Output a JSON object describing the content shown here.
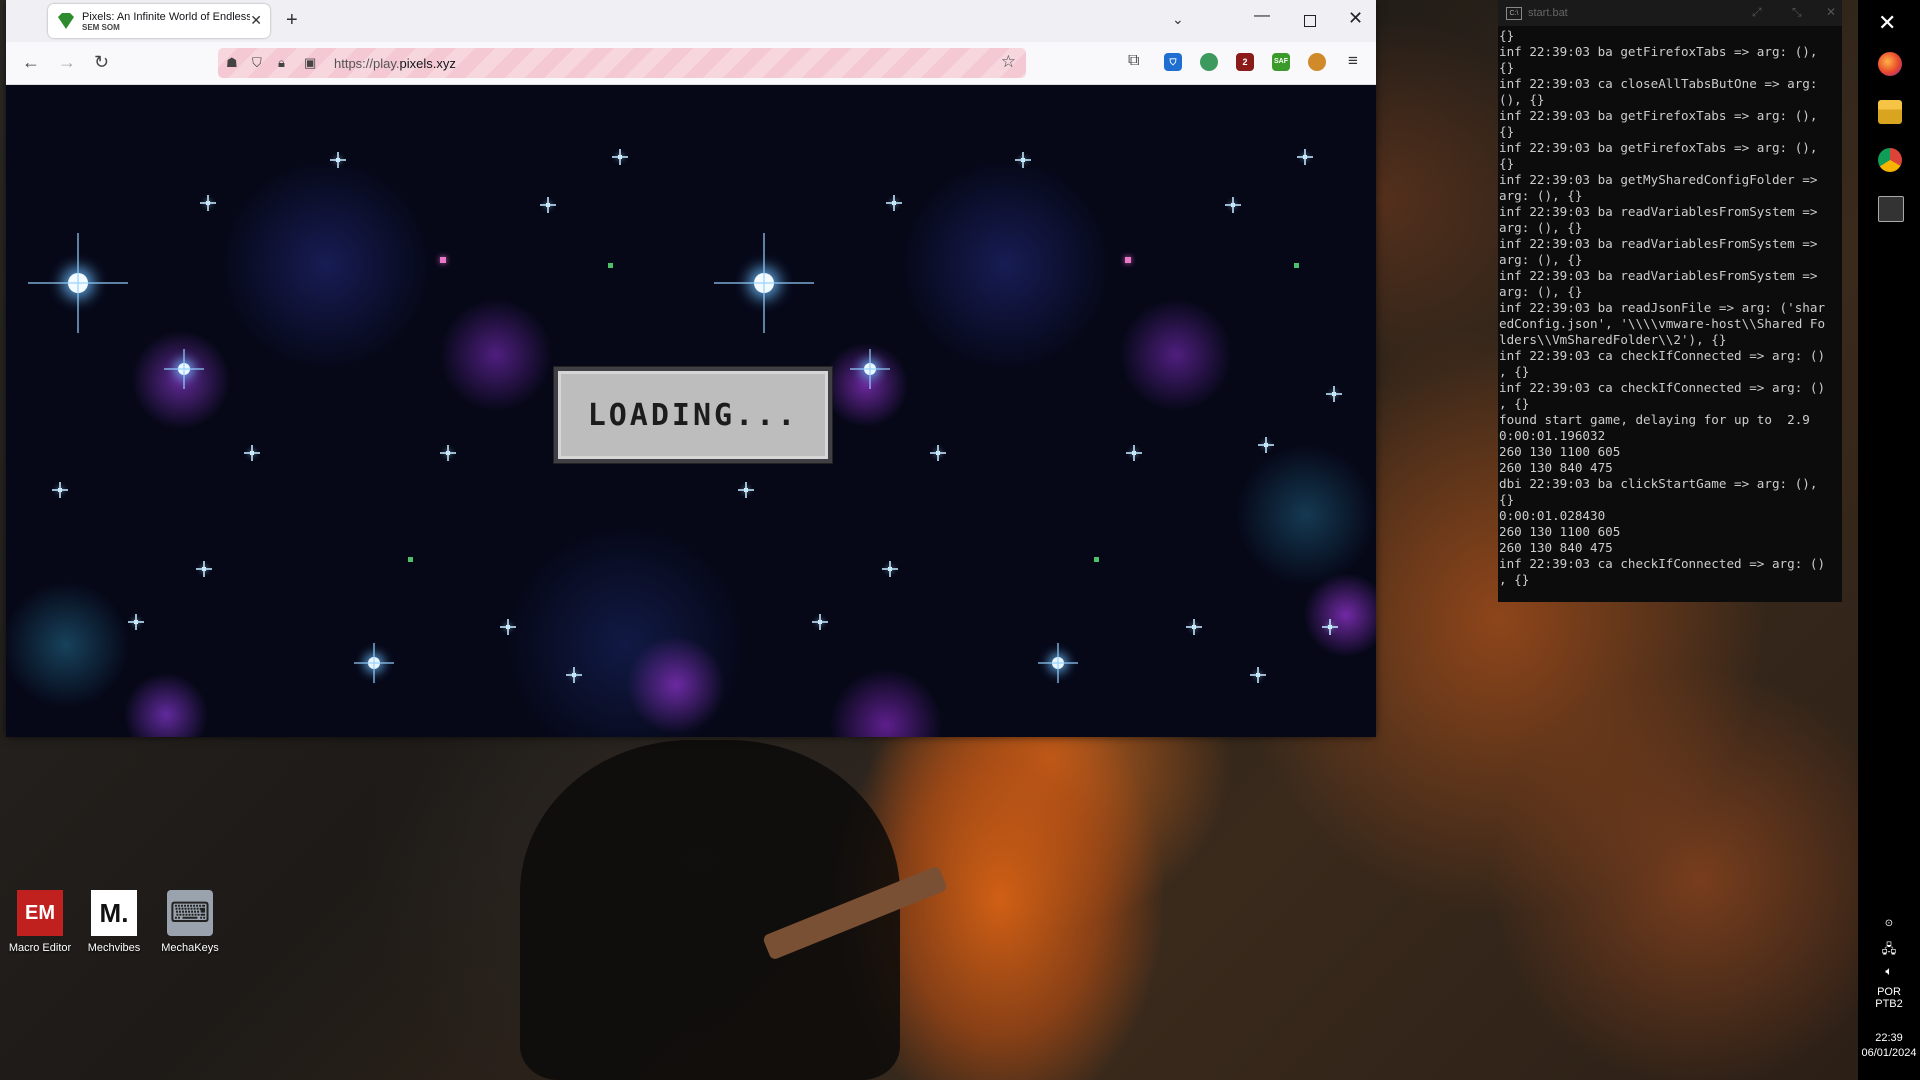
{
  "browser": {
    "tab_title": "Pixels: An Infinite World of Endless",
    "tab_subtitle": "SEM SOM",
    "url_prefix": "https://play.",
    "url_domain": "pixels.xyz",
    "extension_badges": [
      "",
      "2",
      "SAF"
    ]
  },
  "game": {
    "loading_text": "LOADING..."
  },
  "desktop": {
    "icons": [
      {
        "label": "Macro Editor",
        "glyph": "EM"
      },
      {
        "label": "Mechvibes",
        "glyph": "M."
      },
      {
        "label": "MechaKeys",
        "glyph": "⌨"
      }
    ]
  },
  "console": {
    "title": "start.bat",
    "lines": [
      "{}",
      "inf 22:39:03 ba getFirefoxTabs => arg: (),",
      "{}",
      "inf 22:39:03 ca closeAllTabsButOne => arg:",
      "(), {}",
      "inf 22:39:03 ba getFirefoxTabs => arg: (),",
      "{}",
      "inf 22:39:03 ba getFirefoxTabs => arg: (),",
      "{}",
      "inf 22:39:03 ba getMySharedConfigFolder =>",
      "arg: (), {}",
      "inf 22:39:03 ba readVariablesFromSystem =>",
      "arg: (), {}",
      "inf 22:39:03 ba readVariablesFromSystem =>",
      "arg: (), {}",
      "inf 22:39:03 ba readVariablesFromSystem =>",
      "arg: (), {}",
      "inf 22:39:03 ba readJsonFile => arg: ('shar",
      "edConfig.json', '\\\\\\\\vmware-host\\\\Shared Fo",
      "lders\\\\VmSharedFolder\\\\2'), {}",
      "inf 22:39:03 ca checkIfConnected => arg: ()",
      ", {}",
      "inf 22:39:03 ca checkIfConnected => arg: ()",
      ", {}",
      "found start game, delaying for up to  2.9",
      "0:00:01.196032",
      "260 130 1100 605",
      "260 130 840 475",
      "dbi 22:39:03 ba clickStartGame => arg: (),",
      "{}",
      "0:00:01.028430",
      "260 130 1100 605",
      "260 130 840 475",
      "inf 22:39:03 ca checkIfConnected => arg: ()",
      ", {}"
    ]
  },
  "taskbar": {
    "lang_1": "POR",
    "lang_2": "PTB2",
    "time": "22:39",
    "date": "06/01/2024"
  }
}
